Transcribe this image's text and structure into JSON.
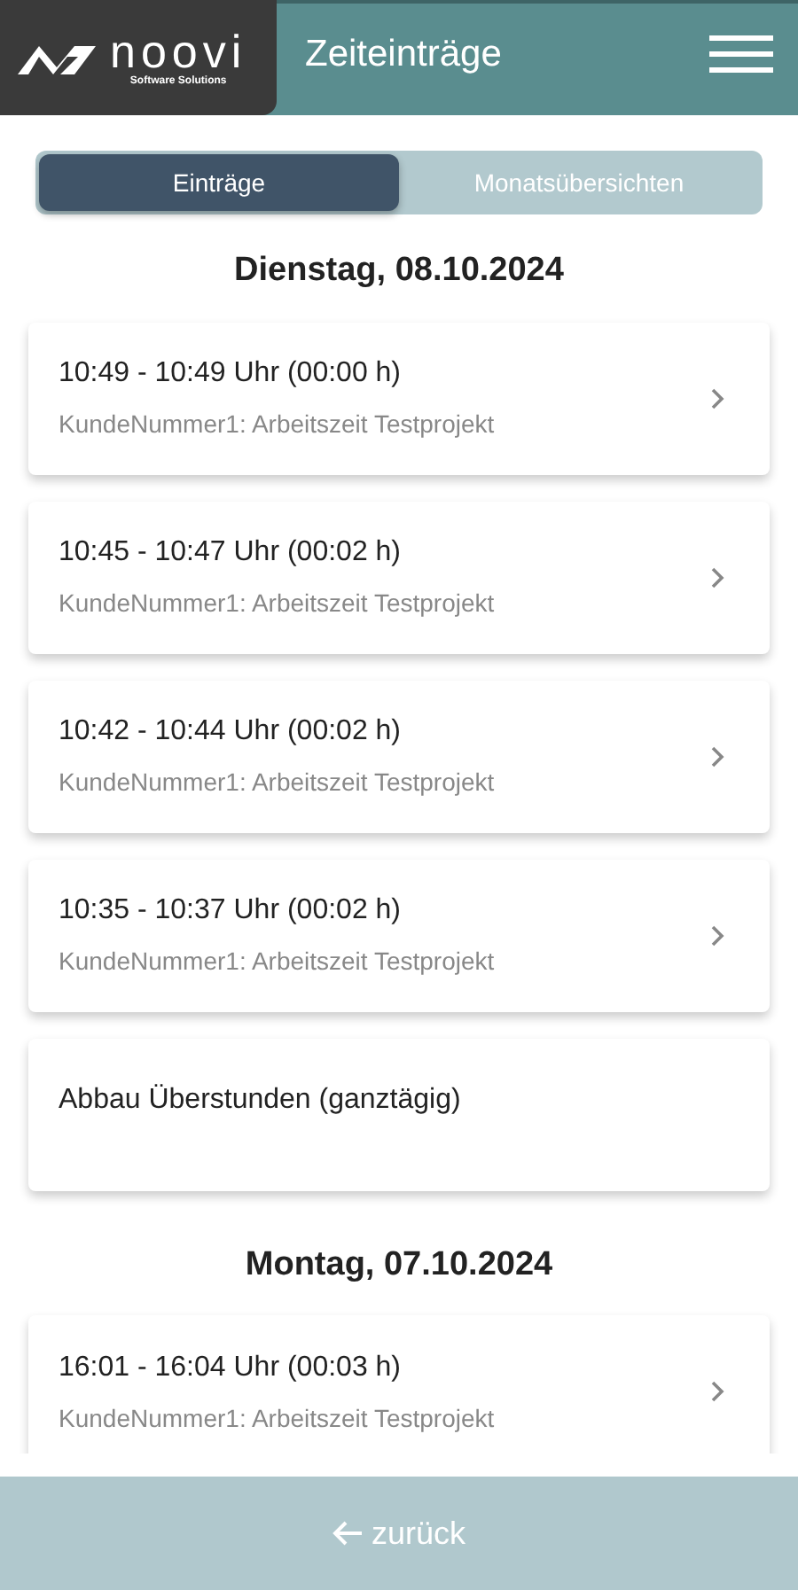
{
  "header": {
    "logo": {
      "name": "noovi",
      "tagline": "Software Solutions"
    },
    "title": "Zeiteinträge"
  },
  "tabs": [
    {
      "label": "Einträge",
      "selected": true
    },
    {
      "label": "Monatsübersichten",
      "selected": false
    }
  ],
  "days": [
    {
      "heading": "Dienstag, 08.10.2024",
      "entries": [
        {
          "kind": "entry",
          "time": "10:49 - 10:49 Uhr (00:00 h)",
          "detail": "KundeNummer1: Arbeitszeit Testprojekt"
        },
        {
          "kind": "entry",
          "time": "10:45 - 10:47 Uhr (00:02 h)",
          "detail": "KundeNummer1: Arbeitszeit Testprojekt"
        },
        {
          "kind": "entry",
          "time": "10:42 - 10:44 Uhr (00:02 h)",
          "detail": "KundeNummer1: Arbeitszeit Testprojekt"
        },
        {
          "kind": "entry",
          "time": "10:35 - 10:37 Uhr (00:02 h)",
          "detail": "KundeNummer1: Arbeitszeit Testprojekt"
        },
        {
          "kind": "absence",
          "time": "Abbau Überstunden (ganztägig)"
        }
      ]
    },
    {
      "heading": "Montag, 07.10.2024",
      "entries": [
        {
          "kind": "entry",
          "time": "16:01 - 16:04 Uhr (00:03 h)",
          "detail": "KundeNummer1: Arbeitszeit Testprojekt"
        }
      ]
    }
  ],
  "footer": {
    "back": "zurück"
  }
}
